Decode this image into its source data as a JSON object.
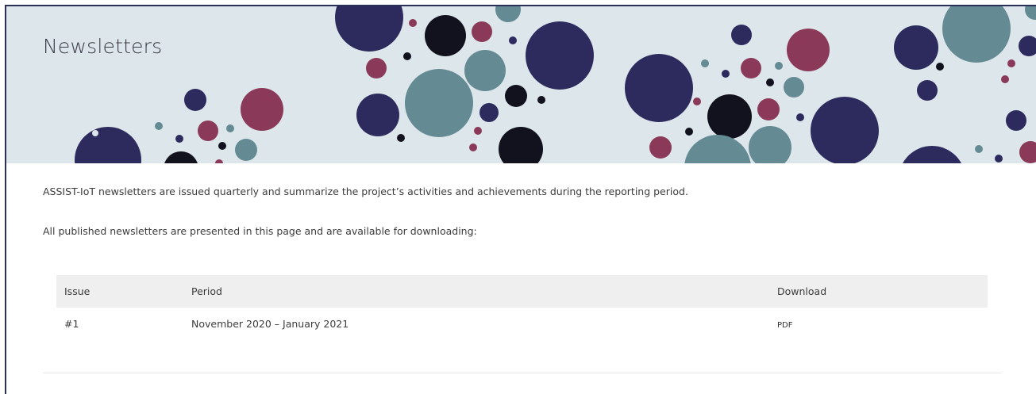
{
  "page": {
    "title": "Newsletters"
  },
  "content": {
    "intro": "ASSIST-IoT newsletters are issued quarterly and summarize the project’s activities and achievements during the reporting period.",
    "intro_download": "All published newsletters are presented in this page and are available for downloading:"
  },
  "table": {
    "headers": {
      "issue": "Issue",
      "period": "Period",
      "download": "Download"
    },
    "rows": [
      {
        "issue": "#1",
        "period": "November 2020 – January 2021",
        "download": "PDF"
      }
    ]
  },
  "colors": {
    "banner_bg": "#dde6ea",
    "navy": "#2d2b5e",
    "teal": "#648a93",
    "maroon": "#8a3a58",
    "black": "#12121e"
  }
}
